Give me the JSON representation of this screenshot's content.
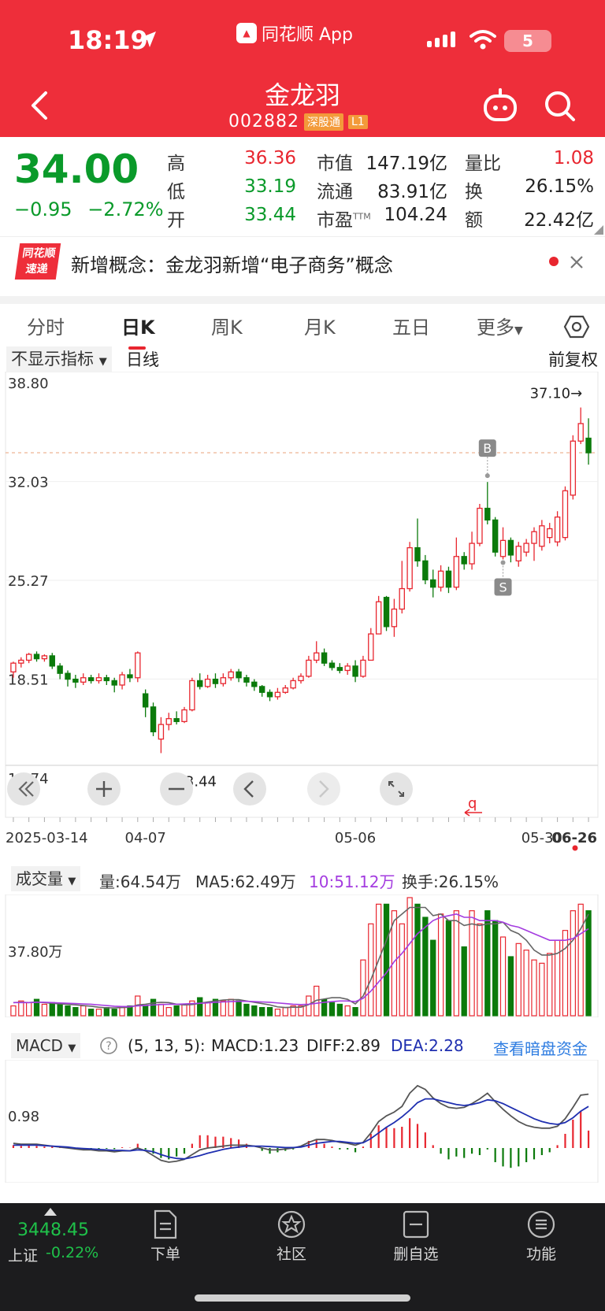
{
  "status": {
    "time": "18:19",
    "app": "同花顺 App",
    "battery": "5"
  },
  "header": {
    "name": "金龙羽",
    "code": "002882",
    "badge1": "深股通",
    "badge2": "L1"
  },
  "quote": {
    "price": "34.00",
    "change": "−0.95",
    "change_pct": "−2.72%",
    "high_label": "高",
    "high": "36.36",
    "low_label": "低",
    "low": "33.19",
    "open_label": "开",
    "open": "33.44",
    "mcap_label": "市值",
    "mcap": "147.19亿",
    "float_label": "流通",
    "float": "83.91亿",
    "pe_label": "市盈",
    "pe_sup": "TTM",
    "pe": "104.24",
    "vr_label": "量比",
    "vr": "1.08",
    "turn_label": "换",
    "turn": "26.15%",
    "amt_label": "额",
    "amt": "22.42亿"
  },
  "news": {
    "logo1": "同花顺",
    "logo2": "速递",
    "text": "新增概念：金龙羽新增“电子商务”概念"
  },
  "tabs": [
    "分时",
    "日K",
    "周K",
    "月K",
    "五日",
    "更多"
  ],
  "chart_toolbar": {
    "indicator": "不显示指标",
    "period": "日线",
    "adjust": "前复权"
  },
  "kline": {
    "y_labels": [
      "38.80",
      "32.03",
      "25.27",
      "18.51",
      "11.74"
    ],
    "x_labels": [
      "2025-03-14",
      "04-07",
      "05-06",
      "05-30",
      "06-26"
    ],
    "max_label": "37.10→",
    "min_label": "←13.44",
    "buy_mark": "B",
    "sell_mark": "S",
    "ref_price": 34.0,
    "ymin": 11.74,
    "ymax": 38.8,
    "candles": [
      [
        19.0,
        19.6,
        19.7,
        18.6
      ],
      [
        19.6,
        19.8,
        20.0,
        19.3
      ],
      [
        19.8,
        20.2,
        20.3,
        19.6
      ],
      [
        20.2,
        19.9,
        20.4,
        19.7
      ],
      [
        19.9,
        20.1,
        20.2,
        19.7
      ],
      [
        20.1,
        19.4,
        20.3,
        19.2
      ],
      [
        19.4,
        18.9,
        19.6,
        18.5
      ],
      [
        18.9,
        18.5,
        19.1,
        18.0
      ],
      [
        18.5,
        18.3,
        18.8,
        17.9
      ],
      [
        18.3,
        18.6,
        18.9,
        18.1
      ],
      [
        18.6,
        18.4,
        18.8,
        18.2
      ],
      [
        18.4,
        18.6,
        18.9,
        18.2
      ],
      [
        18.6,
        18.4,
        18.8,
        18.1
      ],
      [
        18.4,
        18.1,
        18.6,
        17.6
      ],
      [
        18.1,
        18.8,
        19.0,
        17.8
      ],
      [
        18.8,
        18.6,
        19.2,
        18.3
      ],
      [
        18.6,
        20.3,
        20.4,
        18.3
      ],
      [
        17.5,
        16.6,
        17.8,
        15.9
      ],
      [
        16.6,
        14.9,
        16.9,
        14.6
      ],
      [
        14.4,
        15.4,
        15.9,
        13.44
      ],
      [
        15.4,
        15.8,
        16.2,
        15.0
      ],
      [
        15.8,
        15.6,
        16.3,
        15.4
      ],
      [
        15.6,
        16.4,
        16.6,
        15.5
      ],
      [
        16.4,
        18.4,
        18.6,
        16.3
      ],
      [
        18.4,
        18.0,
        18.9,
        17.8
      ],
      [
        18.0,
        18.5,
        18.8,
        17.9
      ],
      [
        18.5,
        18.2,
        18.9,
        17.9
      ],
      [
        18.2,
        18.6,
        18.9,
        18.0
      ],
      [
        18.6,
        19.0,
        19.2,
        18.4
      ],
      [
        19.0,
        18.6,
        19.2,
        18.3
      ],
      [
        18.6,
        18.3,
        18.8,
        18.0
      ],
      [
        18.3,
        18.0,
        18.5,
        17.7
      ],
      [
        18.0,
        17.6,
        18.1,
        17.3
      ],
      [
        17.6,
        17.3,
        17.8,
        17.0
      ],
      [
        17.3,
        17.6,
        17.9,
        17.1
      ],
      [
        17.6,
        17.9,
        18.1,
        17.5
      ],
      [
        17.9,
        18.4,
        18.6,
        17.8
      ],
      [
        18.4,
        18.7,
        18.9,
        18.2
      ],
      [
        18.7,
        19.8,
        20.1,
        18.6
      ],
      [
        19.8,
        20.3,
        21.1,
        19.6
      ],
      [
        20.3,
        19.6,
        20.6,
        19.4
      ],
      [
        19.6,
        19.3,
        19.8,
        19.1
      ],
      [
        19.3,
        19.1,
        19.6,
        18.9
      ],
      [
        19.1,
        19.4,
        19.6,
        18.8
      ],
      [
        19.4,
        18.7,
        19.8,
        18.3
      ],
      [
        18.7,
        19.8,
        20.1,
        18.6
      ],
      [
        19.8,
        21.6,
        22.0,
        19.8
      ],
      [
        21.6,
        23.8,
        24.2,
        21.6
      ],
      [
        24.1,
        22.1,
        24.2,
        21.8
      ],
      [
        22.1,
        23.3,
        24.0,
        21.4
      ],
      [
        23.3,
        24.7,
        26.6,
        23.0
      ],
      [
        24.7,
        27.5,
        27.9,
        24.5
      ],
      [
        27.5,
        26.6,
        29.5,
        26.2
      ],
      [
        26.6,
        25.3,
        27.0,
        25.0
      ],
      [
        25.3,
        24.8,
        26.0,
        24.1
      ],
      [
        24.8,
        25.9,
        26.3,
        24.5
      ],
      [
        25.9,
        24.8,
        26.2,
        24.4
      ],
      [
        24.8,
        26.9,
        28.2,
        24.6
      ],
      [
        26.9,
        26.4,
        27.2,
        26.0
      ],
      [
        26.4,
        27.8,
        28.6,
        26.0
      ],
      [
        27.8,
        30.2,
        30.5,
        27.6
      ],
      [
        30.2,
        29.4,
        32.0,
        29.1
      ],
      [
        29.4,
        27.2,
        29.6,
        26.9
      ],
      [
        26.9,
        28.0,
        28.9,
        26.7
      ],
      [
        28.0,
        27.0,
        28.2,
        26.5
      ],
      [
        26.6,
        27.6,
        27.9,
        26.2
      ],
      [
        27.2,
        27.8,
        28.1,
        26.9
      ],
      [
        27.8,
        28.6,
        28.9,
        26.6
      ],
      [
        27.6,
        29.0,
        29.4,
        27.3
      ],
      [
        28.2,
        28.8,
        29.2,
        27.8
      ],
      [
        27.9,
        29.6,
        30.0,
        27.6
      ],
      [
        28.2,
        31.4,
        31.7,
        28.0
      ],
      [
        31.1,
        34.8,
        35.2,
        30.8
      ],
      [
        34.8,
        36.0,
        37.1,
        34.6
      ],
      [
        35.0,
        34.0,
        36.36,
        33.19
      ]
    ]
  },
  "volume": {
    "selector": "成交量",
    "vol_text": "量:64.54万",
    "ma5_text": "MA5:62.49万",
    "ma10_text": "10:51.12万",
    "turnover_text": "换手:26.15%",
    "y_label": "37.80万",
    "bars": [
      6,
      9,
      8,
      10,
      7,
      8,
      7,
      6,
      5,
      6,
      4,
      4,
      5,
      4,
      5,
      6,
      12,
      6,
      10,
      7,
      5,
      6,
      7,
      9,
      11,
      8,
      10,
      9,
      10,
      9,
      7,
      6,
      5,
      5,
      4,
      5,
      6,
      6,
      12,
      18,
      10,
      8,
      7,
      6,
      5,
      34,
      56,
      68,
      68,
      64,
      56,
      72,
      68,
      60,
      46,
      62,
      58,
      64,
      42,
      64,
      56,
      64,
      58,
      48,
      36,
      44,
      40,
      34,
      32,
      38,
      46,
      52,
      64,
      68,
      64
    ],
    "ma5": [
      8,
      8.2,
      8,
      8.4,
      8,
      7.6,
      7.2,
      7,
      6.6,
      6.2,
      5.8,
      5.2,
      4.8,
      4.8,
      5,
      5.2,
      6.6,
      7,
      7.8,
      8.2,
      8,
      7,
      6.6,
      6.8,
      7.6,
      8.4,
      9,
      9.6,
      9.8,
      9.8,
      9,
      8.2,
      7.4,
      6.6,
      5.4,
      5,
      5.2,
      5.2,
      6.8,
      9.4,
      10.2,
      11,
      11,
      10,
      7.2,
      12,
      22,
      34,
      46,
      58,
      62,
      66,
      66,
      66,
      61,
      62,
      58,
      58,
      55,
      56,
      55,
      56,
      56,
      57,
      52,
      50,
      46,
      40,
      37,
      37,
      38,
      41,
      46,
      53,
      62
    ],
    "ma10": [
      8,
      8,
      8,
      8.2,
      8.2,
      8,
      7.8,
      7.6,
      7.4,
      7.2,
      7,
      6.6,
      6.2,
      5.8,
      5.6,
      5.6,
      6,
      6.2,
      6.6,
      6.8,
      7,
      7,
      7.2,
      7.4,
      7.6,
      7.8,
      8.2,
      8.4,
      8.6,
      8.8,
      8.8,
      8.6,
      8.4,
      8.2,
      7.8,
      7.4,
      7,
      6.8,
      7,
      7.6,
      8.2,
      8.6,
      9,
      9,
      8.6,
      10.6,
      15,
      20.6,
      26.2,
      33,
      38,
      44,
      50,
      54,
      58,
      60,
      61,
      62,
      60,
      60,
      58,
      58,
      58,
      57,
      55,
      54,
      52,
      50,
      48,
      46,
      46,
      46,
      47,
      50,
      53
    ]
  },
  "macd": {
    "selector": "MACD",
    "params": "(5, 13, 5):",
    "macd_text": "MACD:1.23",
    "diff_text": "DIFF:2.89",
    "dea_text": "DEA:2.28",
    "link": "查看暗盘资金",
    "y_label": "0.98",
    "hist": [
      0.2,
      0.15,
      0.2,
      0.15,
      0.1,
      0.1,
      0.05,
      0.0,
      -0.05,
      -0.05,
      -0.05,
      -0.05,
      -0.05,
      -0.08,
      0.05,
      0.02,
      0.3,
      -0.1,
      -0.4,
      -0.7,
      -0.8,
      -0.6,
      -0.4,
      0.3,
      0.9,
      0.9,
      0.8,
      0.8,
      0.7,
      0.6,
      0.3,
      0.0,
      -0.2,
      -0.4,
      -0.3,
      -0.2,
      -0.1,
      0.0,
      0.5,
      0.6,
      0.3,
      0.1,
      -0.1,
      -0.1,
      -0.3,
      0.1,
      1.0,
      1.6,
      1.5,
      1.4,
      1.5,
      2.1,
      1.7,
      1.1,
      0.2,
      -0.4,
      -0.8,
      -0.6,
      -0.7,
      -0.4,
      -0.5,
      -0.1,
      -1.0,
      -1.3,
      -1.4,
      -1.3,
      -1.0,
      -0.8,
      -0.5,
      -0.3,
      0.2,
      1.0,
      2.0,
      2.6,
      1.23
    ],
    "diff": [
      0.5,
      0.4,
      0.4,
      0.4,
      0.3,
      0.2,
      0.1,
      0.0,
      -0.1,
      -0.2,
      -0.2,
      -0.3,
      -0.3,
      -0.4,
      -0.3,
      -0.3,
      0.0,
      -0.3,
      -0.8,
      -1.3,
      -1.5,
      -1.4,
      -1.2,
      -0.7,
      -0.2,
      0.0,
      0.1,
      0.2,
      0.3,
      0.3,
      0.3,
      0.2,
      0.0,
      -0.2,
      -0.2,
      -0.1,
      0.0,
      0.2,
      0.6,
      0.9,
      0.9,
      0.8,
      0.6,
      0.5,
      0.3,
      0.6,
      1.6,
      2.8,
      3.4,
      3.8,
      4.4,
      5.8,
      6.6,
      6.2,
      5.3,
      4.7,
      4.3,
      4.2,
      4.3,
      4.7,
      5.2,
      5.8,
      4.9,
      4.1,
      3.4,
      2.8,
      2.4,
      2.2,
      2.1,
      2.1,
      2.3,
      3.1,
      4.3,
      5.6,
      5.7
    ],
    "dea": [
      0.3,
      0.3,
      0.3,
      0.3,
      0.25,
      0.2,
      0.15,
      0.1,
      0.0,
      -0.05,
      -0.1,
      -0.15,
      -0.2,
      -0.25,
      -0.25,
      -0.3,
      -0.2,
      -0.25,
      -0.4,
      -0.7,
      -0.95,
      -1.1,
      -1.15,
      -1.0,
      -0.8,
      -0.55,
      -0.35,
      -0.15,
      0.0,
      0.1,
      0.2,
      0.2,
      0.2,
      0.15,
      0.1,
      0.05,
      0.05,
      0.1,
      0.3,
      0.5,
      0.6,
      0.7,
      0.7,
      0.6,
      0.5,
      0.55,
      1.0,
      1.6,
      2.2,
      2.7,
      3.3,
      4.0,
      4.8,
      5.2,
      5.2,
      5.0,
      4.8,
      4.6,
      4.5,
      4.6,
      4.8,
      5.1,
      5.0,
      4.7,
      4.3,
      3.9,
      3.5,
      3.1,
      2.8,
      2.6,
      2.5,
      2.7,
      3.2,
      3.9,
      4.4
    ]
  },
  "bottom": {
    "index_value": "3448.45",
    "index_name": "上证",
    "index_change": "-0.22%",
    "nav": [
      "下单",
      "社区",
      "删自选",
      "功能"
    ]
  },
  "colors": {
    "up": "#e8262f",
    "down": "#0b7a0b",
    "header": "#ee2e3a",
    "ma5": "#666666",
    "ma10": "#a43ce0",
    "diff": "#555555",
    "dea": "#1f2fb0",
    "link": "#2f7de1"
  }
}
